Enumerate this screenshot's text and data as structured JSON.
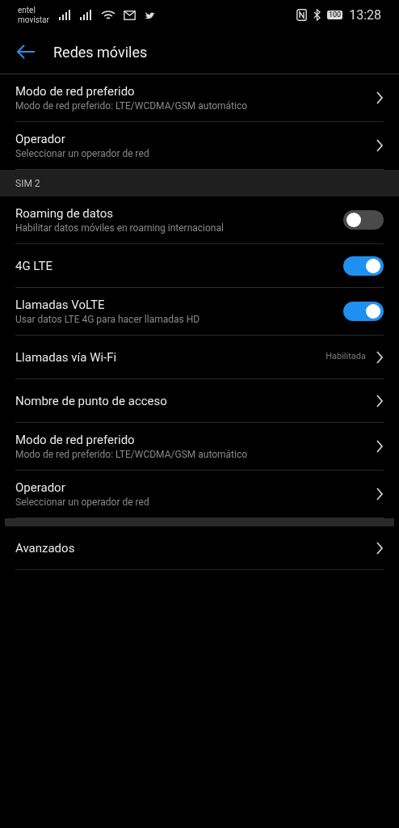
{
  "status_bar": {
    "carriers": [
      "entel",
      "movistar"
    ],
    "battery": "100",
    "time": "13:28"
  },
  "header": {
    "title": "Redes móviles"
  },
  "sections": [
    {
      "items": [
        {
          "kind": "nav",
          "title": "Modo de red preferido",
          "subtitle": "Modo de red preferido: LTE/WCDMA/GSM automático"
        },
        {
          "kind": "nav",
          "title": "Operador",
          "subtitle": "Seleccionar un operador de red"
        }
      ]
    },
    {
      "heading": "SIM 2",
      "items": [
        {
          "kind": "toggle",
          "title": "Roaming de datos",
          "subtitle": "Habilitar datos móviles en roaming internacional",
          "on": false
        },
        {
          "kind": "toggle",
          "title": "4G LTE",
          "on": true
        },
        {
          "kind": "toggle",
          "title": "Llamadas VoLTE",
          "subtitle": "Usar datos LTE 4G para hacer llamadas HD",
          "on": true
        },
        {
          "kind": "nav",
          "title": "Llamadas vía Wi-Fi",
          "value": "Habilitada"
        },
        {
          "kind": "nav",
          "title": "Nombre de punto de acceso"
        },
        {
          "kind": "nav",
          "title": "Modo de red preferido",
          "subtitle": "Modo de red preferido: LTE/WCDMA/GSM automático"
        },
        {
          "kind": "nav",
          "title": "Operador",
          "subtitle": "Seleccionar un operador de red"
        }
      ]
    },
    {
      "gap": true,
      "items": [
        {
          "kind": "nav",
          "title": "Avanzados"
        }
      ]
    }
  ]
}
